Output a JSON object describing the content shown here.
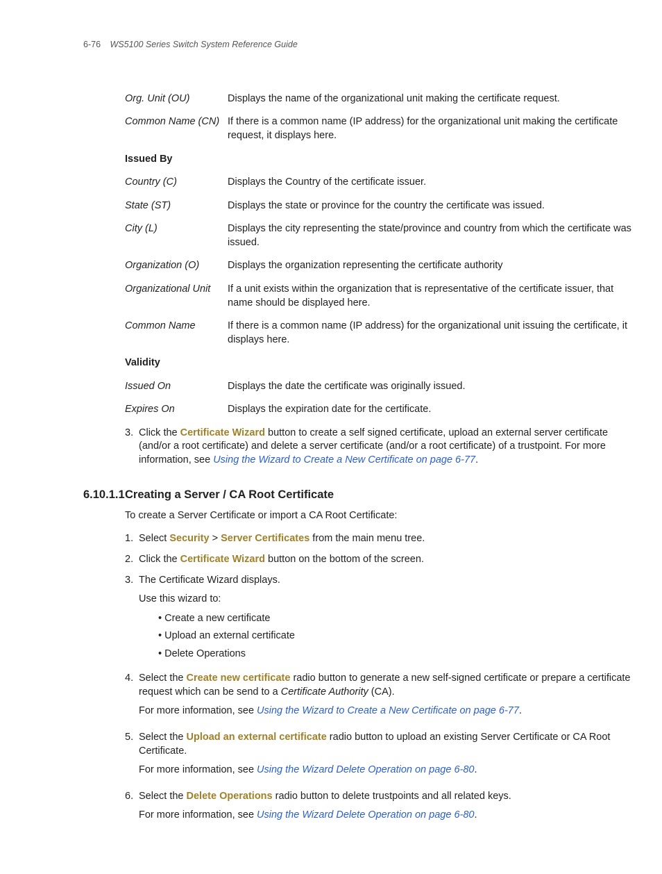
{
  "header": {
    "pagenum": "6-76",
    "title": "WS5100 Series Switch System Reference Guide"
  },
  "defs": [
    {
      "term": "Org. Unit (OU)",
      "desc": "Displays the name of the organizational unit making the certificate request."
    },
    {
      "term": "Common Name (CN)",
      "desc": "If there is a common name (IP address) for the organizational unit making the certificate request, it displays here."
    },
    {
      "term": "Issued By",
      "bold": true,
      "desc": ""
    },
    {
      "term": "Country (C)",
      "desc": "Displays the Country of the certificate issuer."
    },
    {
      "term": "State (ST)",
      "desc": "Displays the state or province for the country the certificate was issued."
    },
    {
      "term": "City (L)",
      "desc": "Displays the city representing the state/province and country from which the certificate was issued."
    },
    {
      "term": "Organization (O)",
      "desc": "Displays the organization representing the certificate authority"
    },
    {
      "term": "Organizational Unit",
      "desc": "If a unit exists within the organization that is representative of the certificate issuer, that name should be displayed here."
    },
    {
      "term": "Common Name",
      "desc": "If there is a common name (IP address) for the organizational unit issuing the certificate, it displays here."
    },
    {
      "term": "Validity",
      "bold": true,
      "desc": ""
    },
    {
      "term": "Issued On",
      "desc": "Displays the date the certificate was originally issued."
    },
    {
      "term": "Expires On",
      "desc": "Displays the expiration date for the certificate."
    }
  ],
  "step3": {
    "pre": "Click the ",
    "bold": "Certificate Wizard",
    "post": " button to create a self signed certificate, upload an external server certificate (and/or a root certificate) and delete a server certificate (and/or a root certificate) of a trustpoint. For more information, see ",
    "link": "Using the Wizard to Create a New Certificate on page 6-77",
    "end": "."
  },
  "section": {
    "num": "6.10.1.1",
    "title": "Creating a Server / CA Root Certificate"
  },
  "intro": "To create a Server Certificate or import a CA Root Certificate:",
  "s1": {
    "pre": "Select ",
    "b1": "Security",
    "sep": " > ",
    "b2": "Server Certificates",
    "post": " from the main menu tree."
  },
  "s2": {
    "pre": "Click the ",
    "b": "Certificate Wizard",
    "post": " button on the bottom of the screen."
  },
  "s3": {
    "line1": "The Certificate Wizard displays.",
    "line2": "Use this wizard to:",
    "b1": "Create a new certificate",
    "b2": "Upload an external certificate",
    "b3": "Delete Operations"
  },
  "s4": {
    "pre": "Select the ",
    "b": "Create new certificate",
    "post1": " radio button to generate a new self-signed certificate or prepare a certificate request which can be send to a ",
    "ital": "Certificate Authority",
    "post2": " (CA).",
    "more": "For more information, see ",
    "link": "Using the Wizard to Create a New Certificate on page 6-77",
    "end": "."
  },
  "s5": {
    "pre": "Select the ",
    "b": "Upload an external certificate",
    "post": " radio button to upload an existing Server Certificate or CA Root Certificate.",
    "more": "For more information, see ",
    "link": "Using the Wizard Delete Operation on page 6-80",
    "end": "."
  },
  "s6": {
    "pre": "Select the ",
    "b": "Delete Operations",
    "post": " radio button to delete trustpoints and all related keys.",
    "more": "For more information, see ",
    "link": "Using the Wizard Delete Operation on page 6-80",
    "end": "."
  }
}
